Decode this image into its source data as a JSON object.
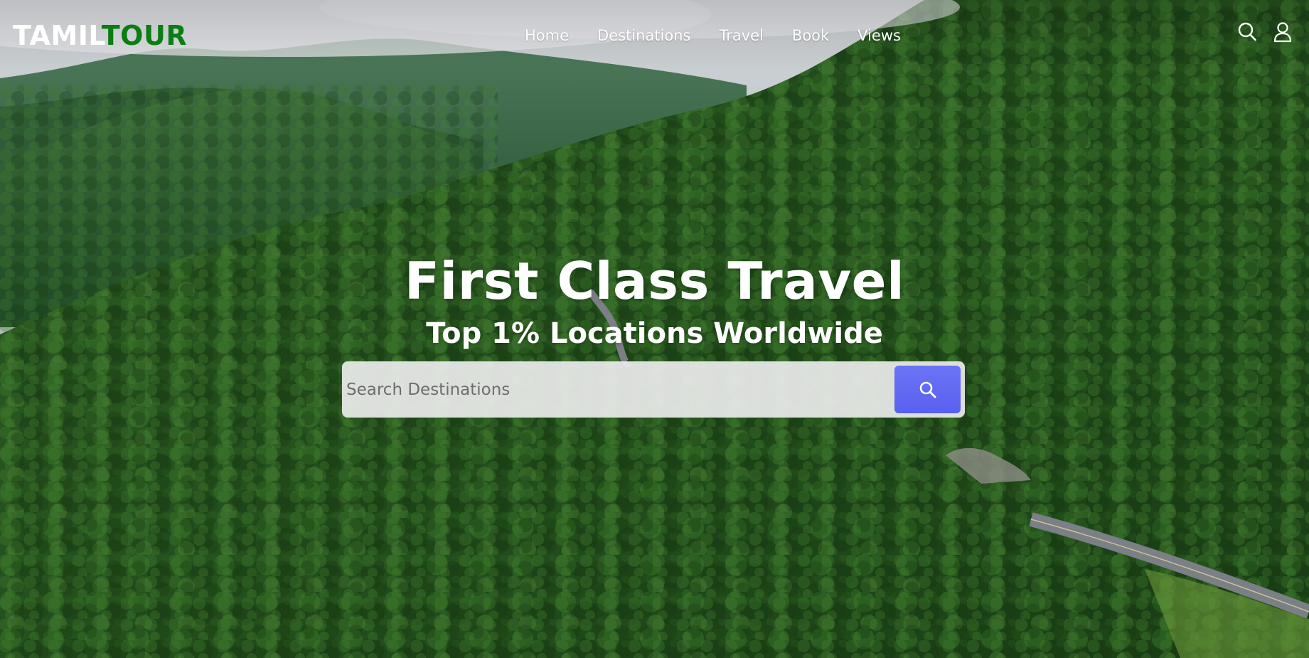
{
  "brand": {
    "part1": "TAMIL",
    "part2": "TOUR",
    "part1_color": "#ffffff",
    "part2_color": "#0b7d12"
  },
  "nav": {
    "links": [
      "Home",
      "Destinations",
      "Travel",
      "Book",
      "Views"
    ],
    "icons": [
      "search-icon",
      "user-icon"
    ]
  },
  "hero": {
    "title": "First Class Travel",
    "subtitle": "Top 1% Locations Worldwide",
    "background": "aerial view of forested mountains with a winding road"
  },
  "search": {
    "placeholder": "Search Destinations",
    "value": "",
    "button_icon": "search-icon",
    "button_color": "#5a60ef"
  }
}
